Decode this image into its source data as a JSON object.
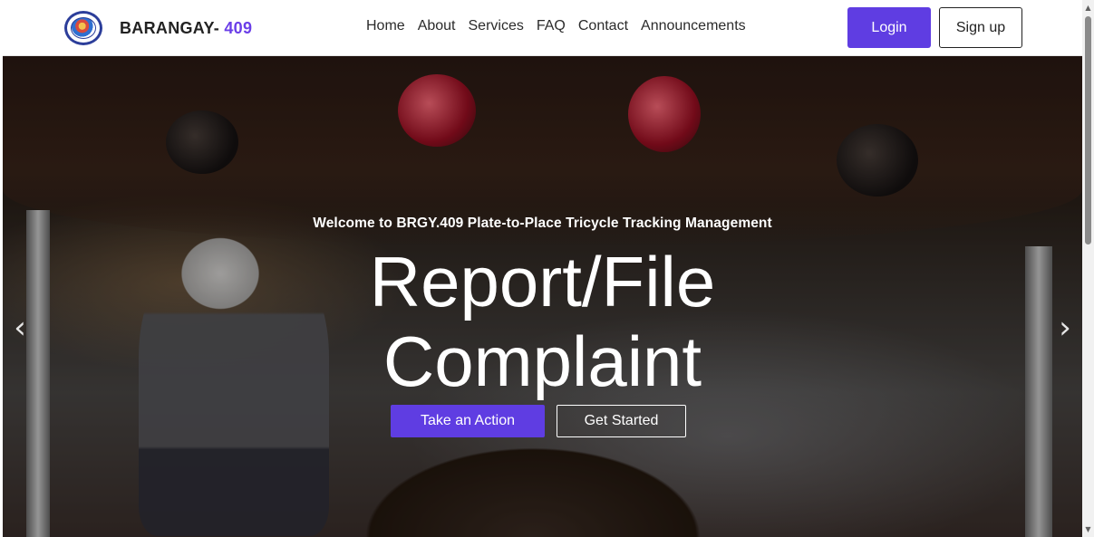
{
  "brand": {
    "name": "BARANGAY-",
    "number": "409"
  },
  "nav": {
    "links": [
      "Home",
      "About",
      "Services",
      "FAQ",
      "Contact",
      "Announcements"
    ],
    "login_label": "Login",
    "signup_label": "Sign up"
  },
  "hero": {
    "welcome": "Welcome to BRGY.409 Plate-to-Place Tricycle Tracking Management",
    "headline_line1": "Report/File",
    "headline_line2": "Complaint",
    "action_label": "Take an Action",
    "started_label": "Get Started",
    "prev_arrow": "‹",
    "next_arrow": "›"
  },
  "colors": {
    "accent": "#5f3de2",
    "brand_number": "#6a3ee8"
  },
  "icons": {
    "logo": "barangay-seal-logo",
    "prev": "chevron-left-icon",
    "next": "chevron-right-icon"
  }
}
